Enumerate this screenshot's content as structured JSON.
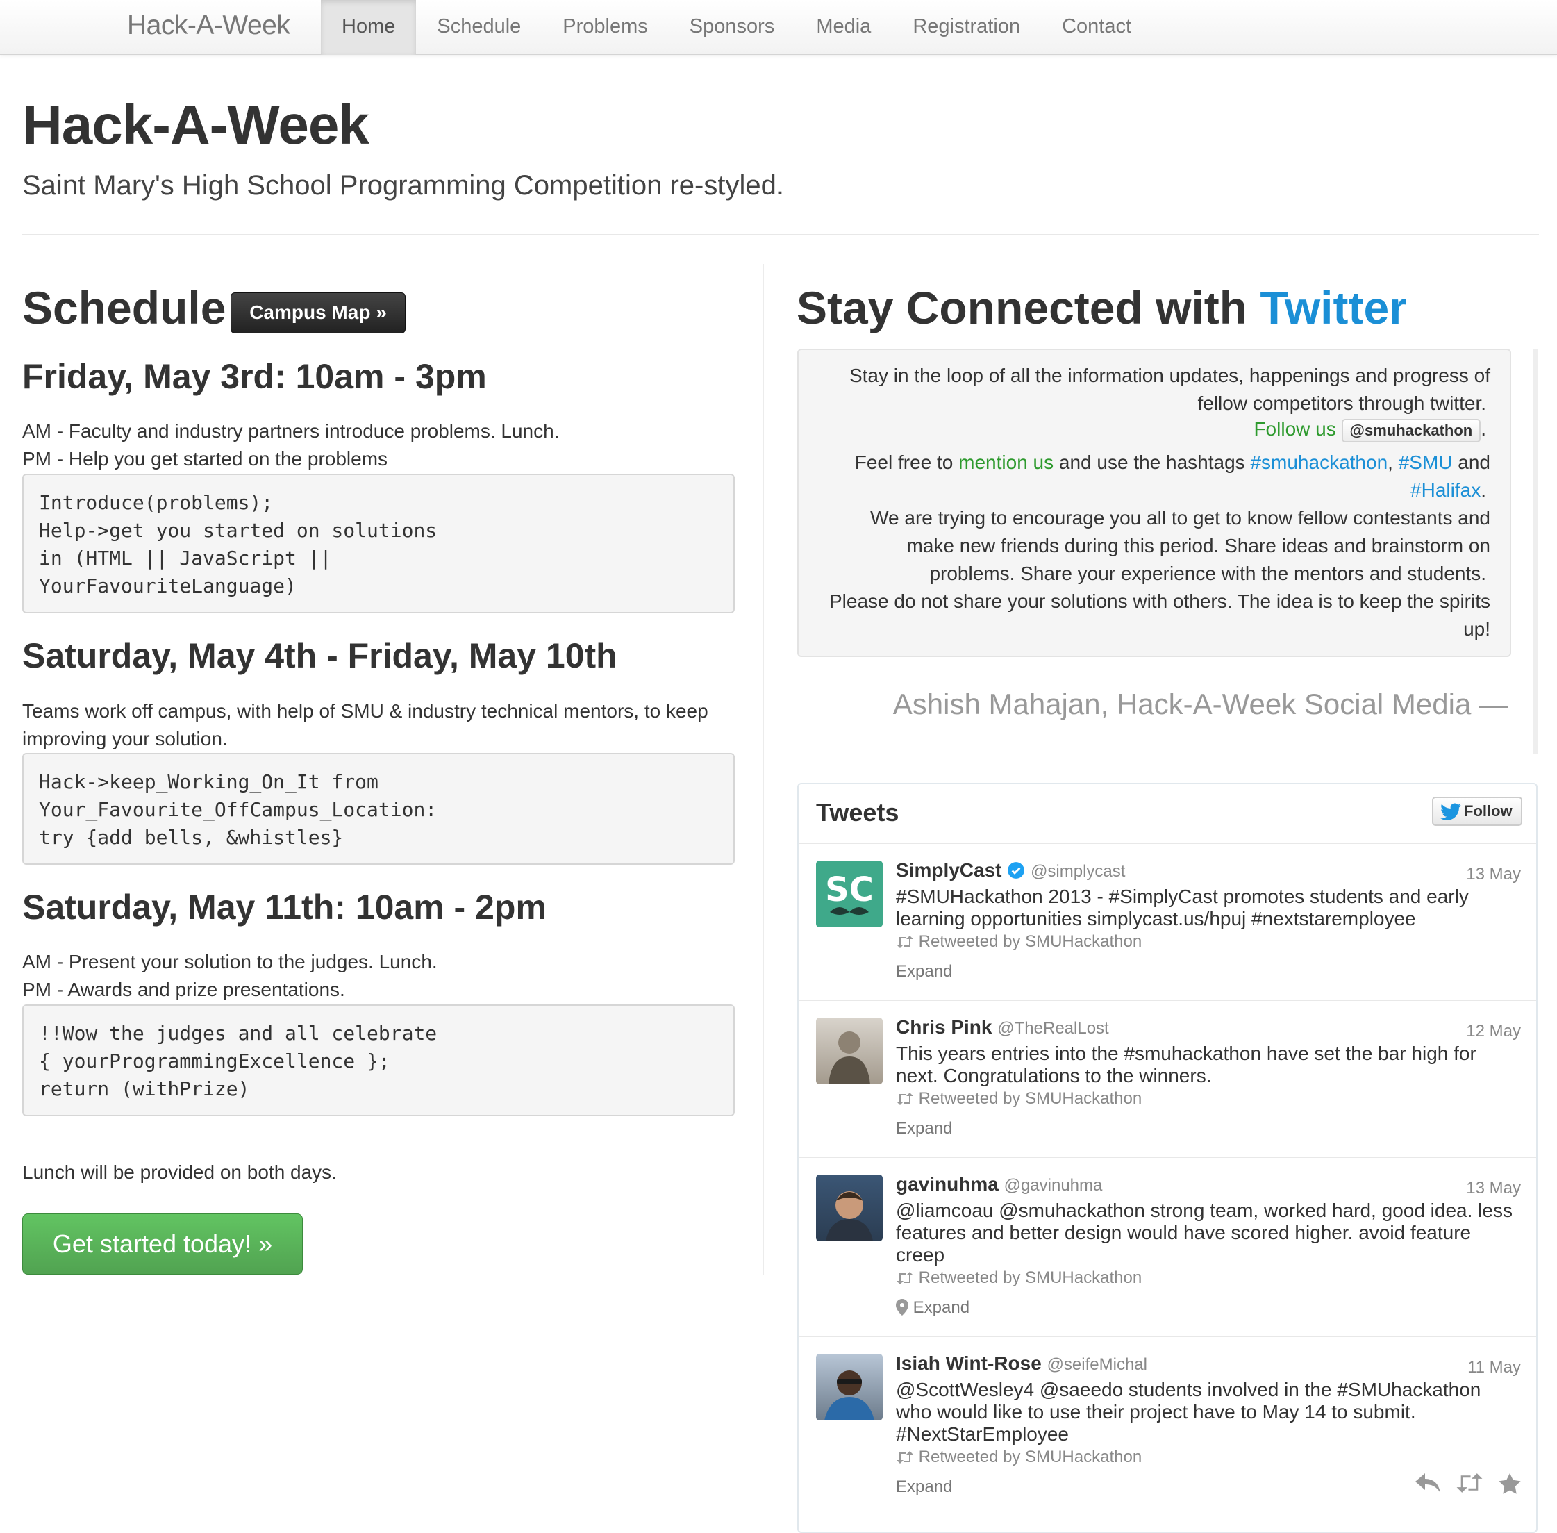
{
  "nav": {
    "brand": "Hack-A-Week",
    "items": [
      {
        "label": "Home",
        "active": true
      },
      {
        "label": "Schedule"
      },
      {
        "label": "Problems"
      },
      {
        "label": "Sponsors"
      },
      {
        "label": "Media"
      },
      {
        "label": "Registration"
      },
      {
        "label": "Contact"
      }
    ]
  },
  "hero": {
    "title": "Hack-A-Week",
    "subtitle": "Saint Mary's High School Programming Competition re-styled."
  },
  "schedule": {
    "heading": "Schedule",
    "campus_map_label": "Campus Map »",
    "days": [
      {
        "heading": "Friday, May 3rd: 10am - 3pm",
        "lines": [
          "AM - Faculty and industry partners introduce problems. Lunch.",
          "PM - Help you get started on the problems"
        ],
        "code": "Introduce(problems);\nHelp->get you started on solutions\nin (HTML || JavaScript ||\nYourFavouriteLanguage)"
      },
      {
        "heading": "Saturday, May 4th - Friday, May 10th",
        "lines": [
          "Teams work off campus, with help of SMU & industry technical mentors, to keep improving your solution."
        ],
        "code": "Hack->keep_Working_On_It from\nYour_Favourite_OffCampus_Location:\ntry {add bells, &whistles}"
      },
      {
        "heading": "Saturday, May 11th: 10am - 2pm",
        "lines": [
          "AM - Present your solution to the judges. Lunch.",
          "PM - Awards and prize presentations."
        ],
        "code": "!!Wow the judges and all celebrate\n{ yourProgrammingExcellence };\nreturn (withPrize)"
      }
    ],
    "lunch_note": "Lunch will be provided on both days.",
    "cta_label": "Get started today! »"
  },
  "connect": {
    "heading_prefix": "Stay Connected with",
    "heading_accent": "Twitter",
    "quote": {
      "line1": "Stay in the loop of all the information updates, happenings and progress of",
      "line2": "fellow competitors through twitter.",
      "follow_us": "Follow us",
      "handle": "@smuhackathon",
      "period": ".",
      "feel_free": "Feel free to",
      "mention_us": "mention us",
      "use_hashtags": "and use the hashtags",
      "hashtag1": "#smuhackathon",
      "comma": ",",
      "hashtag2": "#SMU",
      "and": "and",
      "hashtag3": "#Halifax",
      "line5": "We are trying to encourage you all to get to know fellow contestants and",
      "line6": "make new friends during this period. Share ideas and brainstorm on",
      "line7": "problems. Share your experience with the mentors and students.",
      "line8": "Please do not share your solutions with others. The idea is to keep the spirits",
      "line9": "up!"
    },
    "attribution": "Ashish Mahajan, Hack-A-Week Social Media —"
  },
  "tweets": {
    "title": "Tweets",
    "follow_label": "Follow",
    "items": [
      {
        "name": "SimplyCast",
        "handle": "@simplycast",
        "date": "13 May",
        "text": "#SMUHackathon 2013 - #SimplyCast promotes students and early learning opportunities simplycast.us/hpuj #nextstaremployee",
        "retweet": "Retweeted by SMUHackathon",
        "expand": "Expand",
        "avatar_text": "SC"
      },
      {
        "name": "Chris Pink",
        "handle": "@TheRealLost",
        "date": "12 May",
        "text": "This years entries into the #smuhackathon have set the bar high for next. Congratulations to the winners.",
        "retweet": "Retweeted by SMUHackathon",
        "expand": "Expand"
      },
      {
        "name": "gavinuhma",
        "handle": "@gavinuhma",
        "date": "13 May",
        "text": "@liamcoau @smuhackathon strong team, worked hard, good idea. less features and better design would have scored higher. avoid feature creep",
        "retweet": "Retweeted by SMUHackathon",
        "expand": "Expand"
      },
      {
        "name": "Isiah Wint-Rose",
        "handle": "@seifeMichal",
        "date": "11 May",
        "text": "@ScottWesley4 @saeedo students involved in the #SMUhackathon who would like to use their project have to May 14 to submit. #NextStarEmployee",
        "retweet": "Retweeted by SMUHackathon",
        "expand": "Expand"
      }
    ]
  },
  "colors": {
    "twitter_blue": "#1b8fd6",
    "success_green": "#51a351",
    "mention_green": "#2e9a2e"
  }
}
